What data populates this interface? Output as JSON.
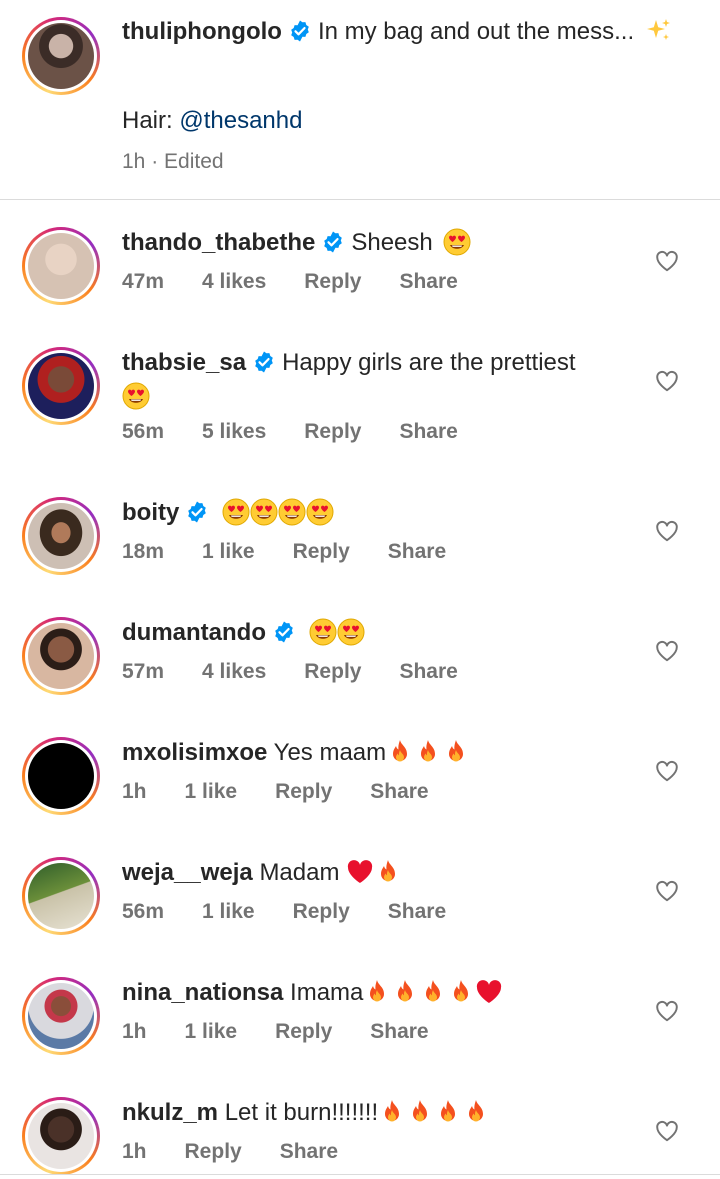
{
  "caption": {
    "username": "thuliphongolo",
    "text": "In my bag and out the mess...",
    "hair_label": "Hair:",
    "hair_mention": "@thesanhd",
    "time": "1h",
    "edited": "· Edited"
  },
  "comments": [
    {
      "username": "thando_thabethe",
      "text": "Sheesh",
      "emoji": "heart-eyes x1",
      "time": "47m",
      "likes": "4 likes",
      "reply": "Reply",
      "share": "Share",
      "verified": true
    },
    {
      "username": "thabsie_sa",
      "text": "Happy girls are the prettiest",
      "emoji": "heart-eyes x1",
      "time": "56m",
      "likes": "5 likes",
      "reply": "Reply",
      "share": "Share",
      "verified": true
    },
    {
      "username": "boity",
      "text": "",
      "emoji": "heart-eyes x4",
      "time": "18m",
      "likes": "1 like",
      "reply": "Reply",
      "share": "Share",
      "verified": true
    },
    {
      "username": "dumantando",
      "text": "",
      "emoji": "heart-eyes x2",
      "time": "57m",
      "likes": "4 likes",
      "reply": "Reply",
      "share": "Share",
      "verified": true
    },
    {
      "username": "mxolisimxoe",
      "text": "Yes maam",
      "emoji": "fire x3",
      "time": "1h",
      "likes": "1 like",
      "reply": "Reply",
      "share": "Share",
      "verified": false
    },
    {
      "username": "weja__weja",
      "text": "Madam",
      "emoji": "red-heart x1 fire x1",
      "time": "56m",
      "likes": "1 like",
      "reply": "Reply",
      "share": "Share",
      "verified": false
    },
    {
      "username": "nina_nationsa",
      "text": "Imama",
      "emoji": "fire x4 red-heart x1",
      "time": "1h",
      "likes": "1 like",
      "reply": "Reply",
      "share": "Share",
      "verified": false
    },
    {
      "username": "nkulz_m",
      "text": "Let it burn!!!!!!!",
      "emoji": "fire x4",
      "time": "1h",
      "reply": "Reply",
      "share": "Share",
      "verified": false
    }
  ],
  "colors": {
    "verified_blue": "#0095f6",
    "meta_gray": "#737373",
    "mention_blue": "#00376b",
    "divider": "#dbdbdb"
  }
}
